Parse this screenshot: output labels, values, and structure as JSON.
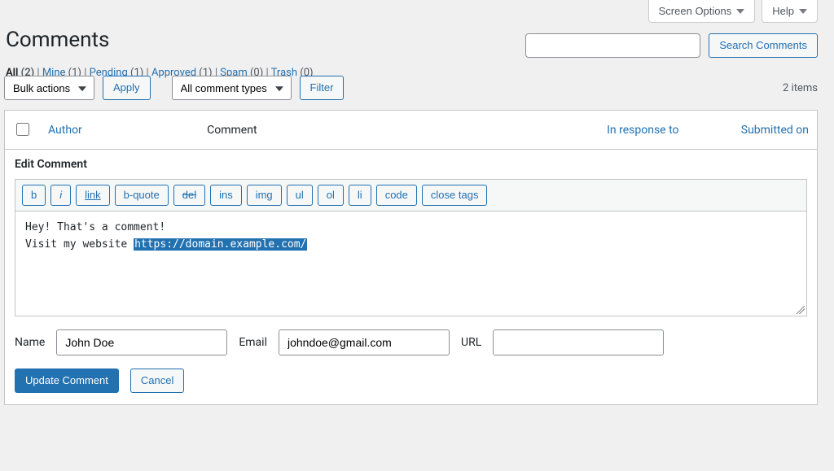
{
  "header": {
    "screen_options": "Screen Options",
    "help": "Help",
    "page_title": "Comments"
  },
  "filters": {
    "all": "All",
    "all_count": "(2)",
    "mine": "Mine",
    "mine_count": "(1)",
    "pending": "Pending",
    "pending_count": "(1)",
    "approved": "Approved",
    "approved_count": "(1)",
    "spam": "Spam",
    "spam_count": "(0)",
    "trash": "Trash",
    "trash_count": "(0)",
    "sep": " | "
  },
  "search": {
    "button": "Search Comments",
    "value": ""
  },
  "tablenav": {
    "bulk_actions": "Bulk actions",
    "apply": "Apply",
    "all_comment_types": "All comment types",
    "filter": "Filter",
    "items_count": "2 items"
  },
  "columns": {
    "author": "Author",
    "comment": "Comment",
    "in_response_to": "In response to",
    "submitted_on": "Submitted on"
  },
  "edit": {
    "heading": "Edit Comment",
    "quicktags": {
      "b": "b",
      "i": "i",
      "link": "link",
      "bquote": "b-quote",
      "del": "del",
      "ins": "ins",
      "img": "img",
      "ul": "ul",
      "ol": "ol",
      "li": "li",
      "code": "code",
      "close": "close tags"
    },
    "content_pre": "Hey! That's a comment!\nVisit my website ",
    "content_selected": "https://domain.example.com/",
    "content_post": "",
    "name_label": "Name",
    "name_value": "John Doe",
    "email_label": "Email",
    "email_value": "johndoe@gmail.com",
    "url_label": "URL",
    "url_value": "",
    "update": "Update Comment",
    "cancel": "Cancel"
  }
}
